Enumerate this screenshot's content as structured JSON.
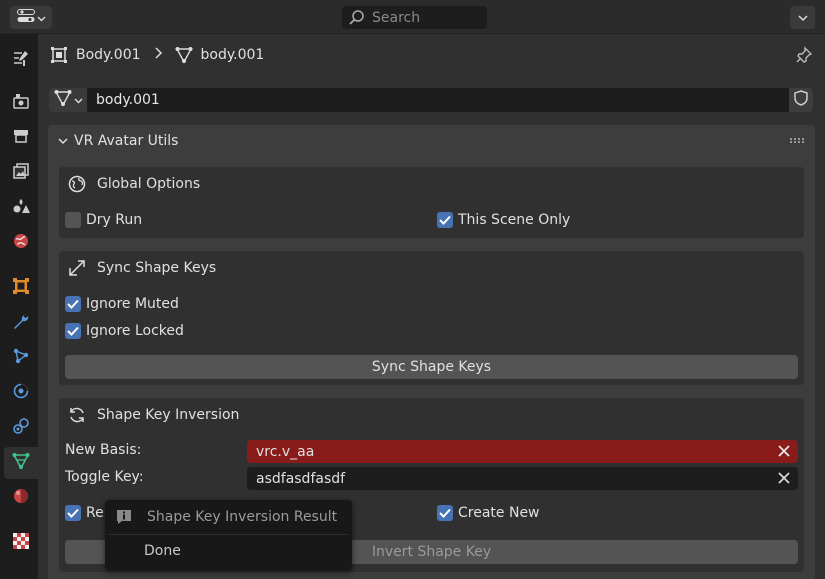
{
  "topbar": {
    "search_placeholder": "Search"
  },
  "left_tabs": [
    {
      "name": "tool-tab",
      "icon": "tool-icon"
    },
    {
      "name": "render-tab",
      "icon": "render-icon"
    },
    {
      "name": "output-tab",
      "icon": "output-icon"
    },
    {
      "name": "view-layer-tab",
      "icon": "view-layer-icon"
    },
    {
      "name": "scene-tab",
      "icon": "scene-icon"
    },
    {
      "name": "world-tab",
      "icon": "world-icon"
    },
    {
      "name": "object-tab",
      "icon": "object-icon"
    },
    {
      "name": "modifier-tab",
      "icon": "wrench-icon"
    },
    {
      "name": "particles-tab",
      "icon": "particles-icon"
    },
    {
      "name": "physics-tab",
      "icon": "physics-icon"
    },
    {
      "name": "constraints-tab",
      "icon": "constraints-icon"
    },
    {
      "name": "data-tab",
      "icon": "mesh-data-icon",
      "active": true
    },
    {
      "name": "material-tab",
      "icon": "material-icon"
    },
    {
      "name": "texture-tab",
      "icon": "texture-icon"
    }
  ],
  "breadcrumb": {
    "object_name": "Body.001",
    "mesh_name": "body.001"
  },
  "datablock": {
    "name": "body.001"
  },
  "panel": {
    "title": "VR Avatar Utils",
    "global_options": {
      "title": "Global Options",
      "dry_run_label": "Dry Run",
      "dry_run_checked": false,
      "this_scene_only_label": "This Scene Only",
      "this_scene_only_checked": true
    },
    "sync_shape_keys": {
      "title": "Sync Shape Keys",
      "ignore_muted_label": "Ignore Muted",
      "ignore_muted_checked": true,
      "ignore_locked_label": "Ignore Locked",
      "ignore_locked_checked": true,
      "button_label": "Sync Shape Keys"
    },
    "shape_key_inversion": {
      "title": "Shape Key Inversion",
      "new_basis_label": "New Basis:",
      "new_basis_value": "vrc.v_aa",
      "toggle_key_label": "Toggle Key:",
      "toggle_key_value": "asdfasdfasdf",
      "remove_label_partial": "Rei",
      "remove_checked": true,
      "create_new_label": "Create New",
      "create_new_checked": true,
      "button_label": "Invert Shape Key"
    }
  },
  "popup": {
    "title": "Shape Key Inversion Result",
    "item": "Done"
  },
  "colors": {
    "accent_blue": "#4772b3",
    "error_red": "#8a1b1b",
    "panel_bg": "#3d3d3d",
    "box_bg": "#303030"
  }
}
